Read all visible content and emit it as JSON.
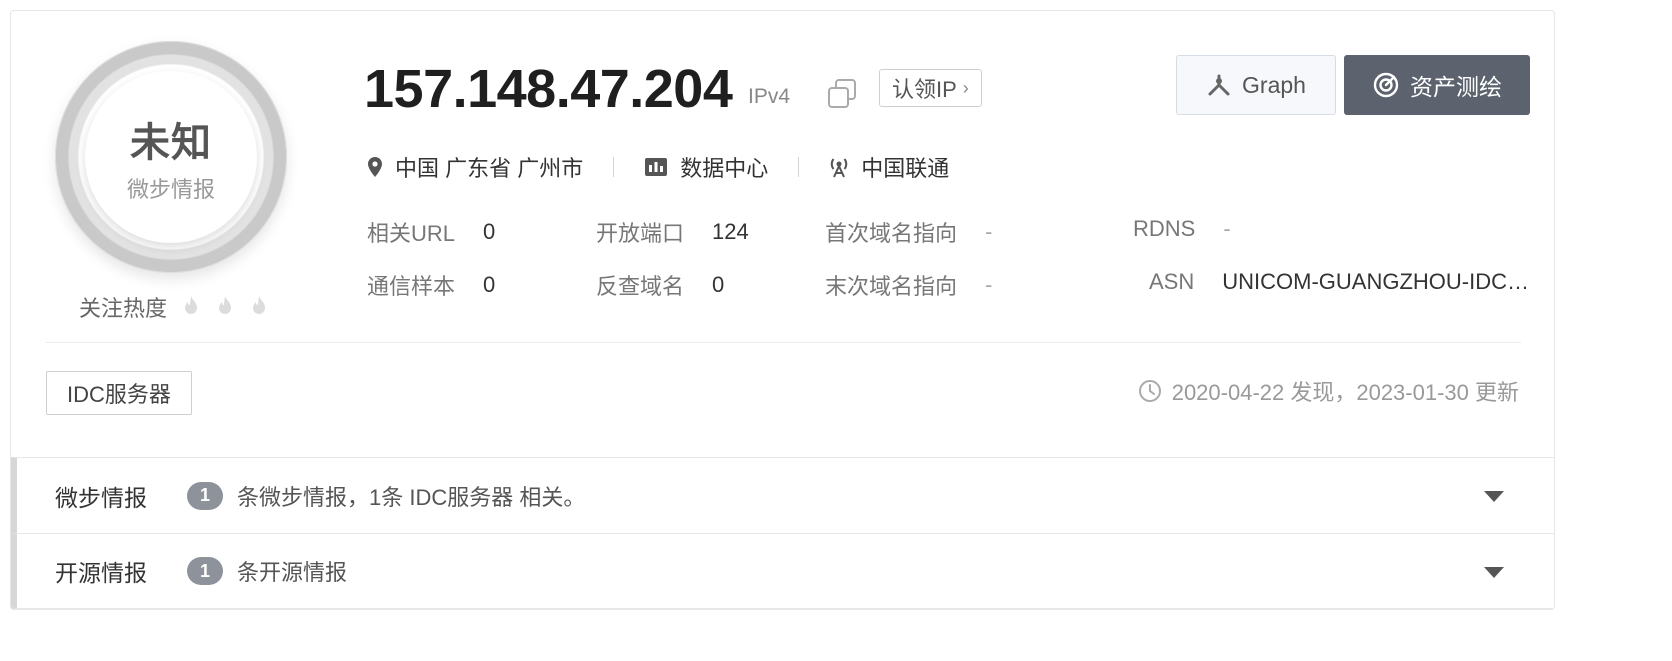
{
  "profile": {
    "ring_title": "未知",
    "ring_subtitle": "微步情报",
    "heat_label": "关注热度",
    "heat_level": 0,
    "heat_max": 3
  },
  "header": {
    "ip": "157.148.47.204",
    "ip_version": "IPv4",
    "claim_label": "认领IP",
    "claim_chevron": "›",
    "graph_button": "Graph",
    "map_button": "资产测绘"
  },
  "meta": {
    "location": "中国 广东省 广州市",
    "type": "数据中心",
    "isp": "中国联通"
  },
  "fields": {
    "related_url_label": "相关URL",
    "related_url_value": "0",
    "open_ports_label": "开放端口",
    "open_ports_value": "124",
    "first_domain_label": "首次域名指向",
    "first_domain_value": "-",
    "rdns_label": "RDNS",
    "rdns_value": "-",
    "comm_samples_label": "通信样本",
    "comm_samples_value": "0",
    "reverse_domain_label": "反查域名",
    "reverse_domain_value": "0",
    "last_domain_label": "末次域名指向",
    "last_domain_value": "-",
    "asn_label": "ASN",
    "asn_value": "UNICOM-GUANGZHOU-IDC…"
  },
  "tags": [
    "IDC服务器"
  ],
  "dates_text": "2020-04-22 发现，2023-01-30 更新",
  "sections": [
    {
      "title": "微步情报",
      "count": "1",
      "text": "条微步情报，1条 IDC服务器 相关。"
    },
    {
      "title": "开源情报",
      "count": "1",
      "text": "条开源情报"
    }
  ],
  "colors": {
    "primary_button": "#5c636e",
    "badge": "#8e939b",
    "ring": "#c9c9c9"
  }
}
